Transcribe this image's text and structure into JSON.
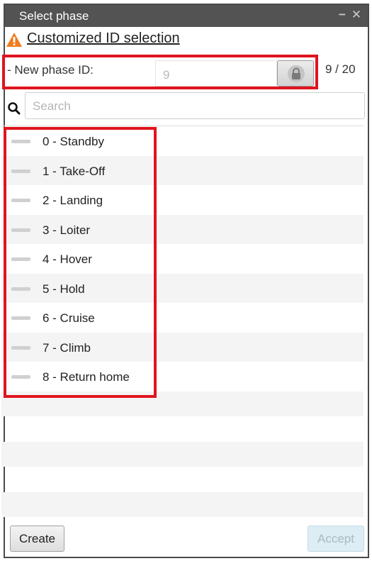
{
  "window": {
    "title": "Select phase",
    "minimize_glyph": "−",
    "close_glyph": "✕"
  },
  "warning": {
    "icon": "warning-triangle-icon",
    "icon_color": "#f07c1e",
    "link_text": "Customized ID selection"
  },
  "new_phase": {
    "label": "- New phase ID:",
    "value": "9",
    "lock_icon": "lock-icon",
    "counter": "9 / 20"
  },
  "search": {
    "icon": "search-icon",
    "placeholder": "Search"
  },
  "phases": [
    {
      "label": "0 - Standby"
    },
    {
      "label": "1 - Take-Off"
    },
    {
      "label": "2 - Landing"
    },
    {
      "label": "3 - Loiter"
    },
    {
      "label": "4 - Hover"
    },
    {
      "label": "5 - Hold"
    },
    {
      "label": "6 - Cruise"
    },
    {
      "label": "7 - Climb"
    },
    {
      "label": "8 - Return home"
    }
  ],
  "buttons": {
    "create": "Create",
    "accept": "Accept"
  },
  "colors": {
    "titlebar": "#535353",
    "highlight": "#e0141e",
    "row_alt": "#f4f4f4",
    "accept_disabled_bg": "#dcedf3"
  }
}
